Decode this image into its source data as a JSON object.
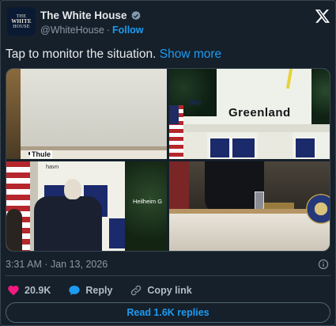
{
  "account": {
    "display_name": "The White House",
    "handle": "@WhiteHouse",
    "separator": "·",
    "follow_label": "Follow",
    "avatar_lines": [
      "THE",
      "WHITE",
      "HOUSE"
    ]
  },
  "tweet": {
    "text": "Tap to monitor the situation.",
    "show_more_label": "Show more"
  },
  "media": {
    "tile1_label": "Thule",
    "tile2_labels": [
      "Bay",
      "Greenland"
    ],
    "tile3_labels": [
      "havn",
      "Heilheim G"
    ]
  },
  "meta": {
    "timestamp": "3:31 AM · Jan 13, 2026"
  },
  "actions": {
    "like_count": "20.9K",
    "reply_label": "Reply",
    "copy_label": "Copy link"
  },
  "footer": {
    "read_replies_label": "Read 1.6K replies"
  },
  "colors": {
    "background": "#15202b",
    "accent": "#1d9bf0",
    "like": "#f91880",
    "muted": "#8b98a5"
  }
}
